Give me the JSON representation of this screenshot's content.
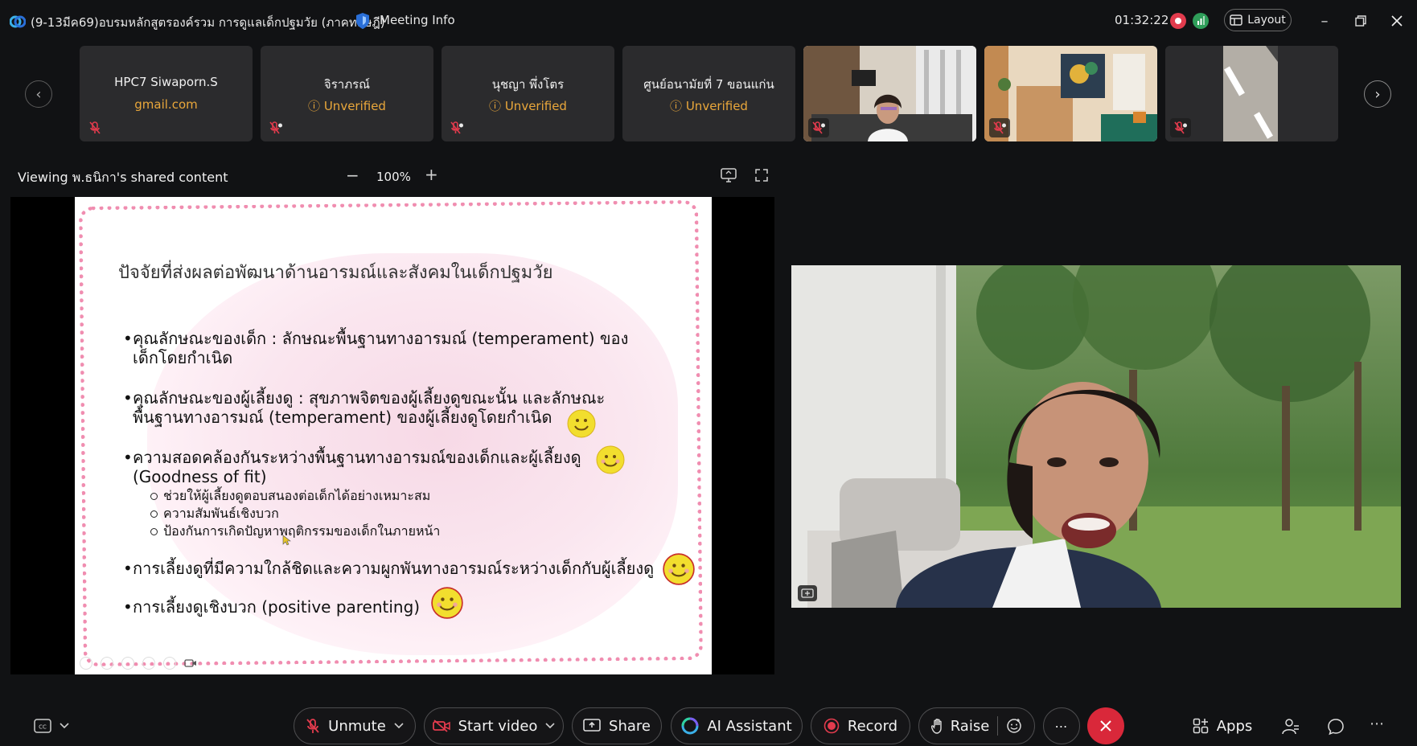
{
  "titlebar": {
    "meeting_title": "(9-13มีค69)อบรมหลักสูตรองค์รวม การดูแลเด็กปฐมวัย (ภาคทฤษฎี)",
    "meeting_info": "Meeting Info",
    "timer": "01:32:22",
    "layout_label": "Layout"
  },
  "participants": [
    {
      "name": "HPC7 Siwaporn.S",
      "sub": "gmail.com",
      "sub_color": "#e9a73b"
    },
    {
      "name": "จิราภรณ์",
      "sub": "Unverified",
      "sub_color": "#e9a73b"
    },
    {
      "name": "นุชญา พึ่งโตร",
      "sub": "Unverified",
      "sub_color": "#e9a73b"
    },
    {
      "name": "ศูนย์อนามัยที่ 7 ขอนแก่น",
      "sub": "Unverified",
      "sub_color": "#e9a73b"
    }
  ],
  "share": {
    "viewing_label": "Viewing พ.ธนิกา's shared content",
    "zoom": "100%"
  },
  "slide": {
    "title": "ปัจจัยที่ส่งผลต่อพัฒนาด้านอารมณ์และสังคมในเด็กปฐมวัย",
    "b1_l1": "คุณลักษณะของเด็ก : ลักษณะพื้นฐานทางอารมณ์ (temperament) ของ",
    "b1_l2": "เด็กโดยกำเนิด",
    "b2_l1": "คุณลักษณะของผู้เลี้ยงดู : สุขภาพจิตของผู้เลี้ยงดูขณะนั้น และลักษณะ",
    "b2_l2": "พื้นฐานทางอารมณ์ (temperament) ของผู้เลี้ยงดูโดยกำเนิด",
    "b3_l1": "ความสอดคล้องกันระหว่างพื้นฐานทางอารมณ์ของเด็กและผู้เลี้ยงดู",
    "b3_l2": "(Goodness of fit)",
    "sub1": "ช่วยให้ผู้เลี้ยงดูตอบสนองต่อเด็กได้อย่างเหมาะสม",
    "sub2": "ความสัมพันธ์เชิงบวก",
    "sub3": "ป้องกันการเกิดปัญหาพฤติกรรมของเด็กในภายหน้า",
    "b4": "การเลี้ยงดูที่มีความใกล้ชิดและความผูกพันทางอารมณ์ระหว่างเด็กกับผู้เลี้ยงดู",
    "b5": "การเลี้ยงดูเชิงบวก (positive parenting)"
  },
  "toolbar": {
    "unmute": "Unmute",
    "start_video": "Start video",
    "share": "Share",
    "ai_assistant": "AI Assistant",
    "record": "Record",
    "raise": "Raise",
    "apps": "Apps"
  },
  "colors": {
    "accent_red": "#e23b4d",
    "unverified": "#e9a73b",
    "end_call": "#d9283a"
  }
}
